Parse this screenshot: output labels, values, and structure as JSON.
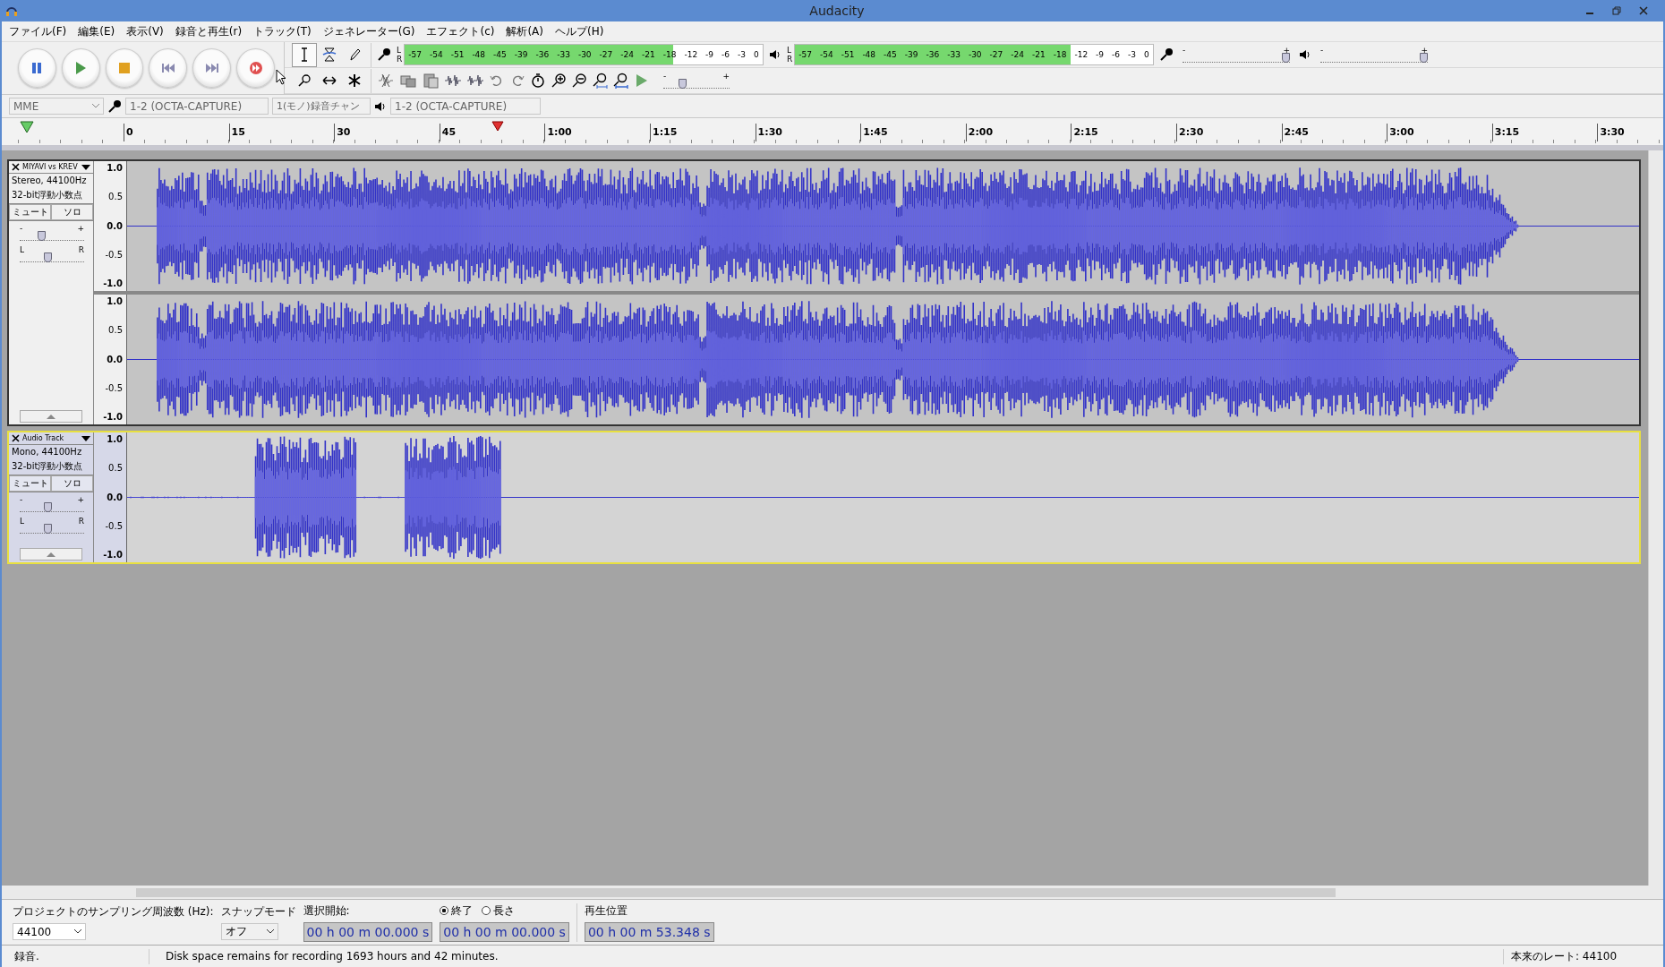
{
  "window": {
    "title": "Audacity"
  },
  "menu": [
    "ファイル(F)",
    "編集(E)",
    "表示(V)",
    "録音と再生(r)",
    "トラック(T)",
    "ジェネレーター(G)",
    "エフェクト(c)",
    "解析(A)",
    "ヘルプ(H)"
  ],
  "tools": [
    {
      "kind": "ibeam",
      "selected": true
    },
    {
      "kind": "envelope",
      "selected": false
    },
    {
      "kind": "pencil",
      "selected": false
    },
    {
      "kind": "zoom",
      "selected": false
    },
    {
      "kind": "timeshift",
      "selected": false
    },
    {
      "kind": "multi",
      "selected": false
    }
  ],
  "record_meter": {
    "channels": [
      "L",
      "R"
    ],
    "ticks": [
      "-57",
      "-54",
      "-51",
      "-48",
      "-45",
      "-39",
      "-36",
      "-33",
      "-30",
      "-27",
      "-24",
      "-21",
      "-18",
      "-12",
      "-9",
      "-6",
      "-3",
      "0"
    ],
    "level": 0.75
  },
  "playback_meter": {
    "channels": [
      "L",
      "R"
    ],
    "ticks": [
      "-57",
      "-54",
      "-51",
      "-48",
      "-45",
      "-39",
      "-36",
      "-33",
      "-30",
      "-27",
      "-24",
      "-21",
      "-18",
      "-12",
      "-9",
      "-6",
      "-3",
      "0"
    ],
    "level": 0.77
  },
  "play_speed": {
    "minus": "-",
    "plus": "+",
    "level": 0.3
  },
  "mixer": {
    "record": {
      "minus": "-",
      "plus": "+",
      "level": 0.97
    },
    "playback": {
      "minus": "-",
      "plus": "+",
      "level": 0.97
    }
  },
  "device": {
    "host": "MME",
    "recording_device": "1-2 (OCTA-CAPTURE)",
    "channels": "1(モノ)録音チャン",
    "playback_device": "1-2 (OCTA-CAPTURE)"
  },
  "ruler": {
    "labels": [
      "0",
      "15",
      "30",
      "45",
      "1:00",
      "1:15",
      "1:30",
      "1:45",
      "2:00",
      "2:15",
      "2:30",
      "2:45",
      "3:00",
      "3:15",
      "3:30"
    ]
  },
  "tracks": [
    {
      "name": "MIYAVI vs KREV",
      "format": "Stereo, 44100Hz",
      "sample_format": "32-bit浮動小数点",
      "mute": "ミュート",
      "solo": "ソロ",
      "gain_minus": "-",
      "gain_plus": "+",
      "pan_left": "L",
      "pan_right": "R",
      "gain": {
        "level": 0.35
      },
      "pan": {
        "level": 0.45
      },
      "selected": false,
      "channels": [
        {
          "scale": [
            "1.0",
            "0.5",
            "0.0",
            "-0.5",
            "-1.0"
          ]
        },
        {
          "scale": [
            "1.0",
            "0.5",
            "0.0",
            "-0.5",
            "-1.0"
          ]
        }
      ]
    },
    {
      "name": "Audio Track",
      "format": "Mono, 44100Hz",
      "sample_format": "32-bit浮動小数点",
      "mute": "ミュート",
      "solo": "ソロ",
      "gain_minus": "-",
      "gain_plus": "+",
      "pan_left": "L",
      "pan_right": "R",
      "gain": {
        "level": 0.45
      },
      "pan": {
        "level": 0.45
      },
      "selected": true,
      "channels": [
        {
          "scale": [
            "1.0",
            "0.5",
            "0.0",
            "-0.5",
            "-1.0"
          ]
        }
      ]
    }
  ],
  "selection_bar": {
    "rate_label": "プロジェクトのサンプリング周波数 (Hz):",
    "rate": "44100",
    "snap_label": "スナップモード",
    "snap": "オフ",
    "start_label": "選択開始:",
    "start": "00 h 00 m 00.000 s",
    "end_options": [
      {
        "label": "終了",
        "selected": true
      },
      {
        "label": "長さ",
        "selected": false
      }
    ],
    "end": "00 h 00 m 00.000 s",
    "position_label": "再生位置",
    "position": "00 h 00 m 53.348 s"
  },
  "status_bar": {
    "state": "録音.",
    "message": "Disk space remains for recording 1693 hours and 42 minutes.",
    "rate": "本来のレート: 44100"
  }
}
